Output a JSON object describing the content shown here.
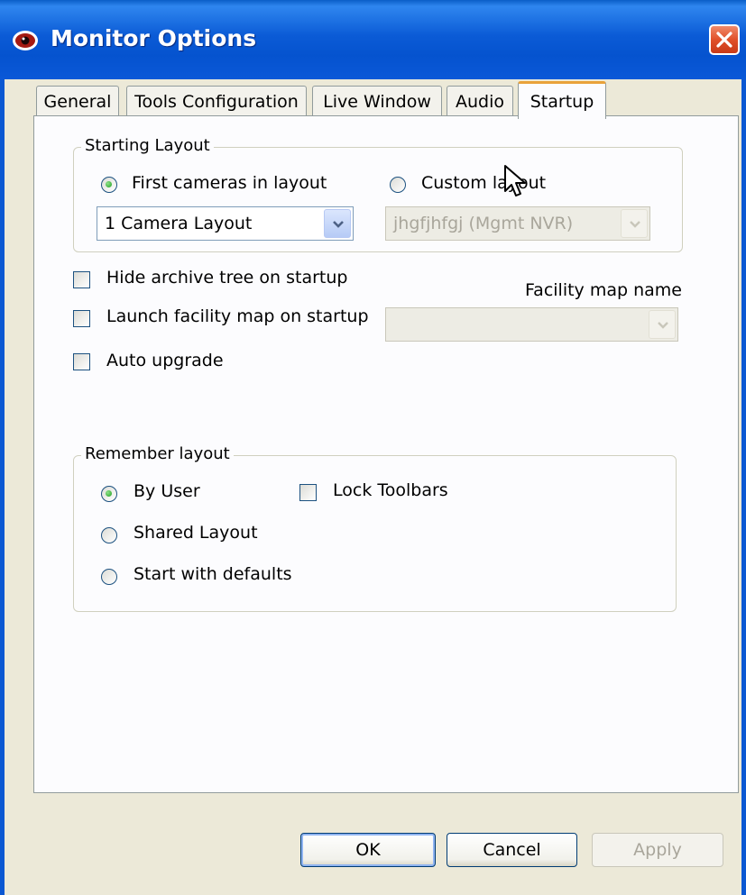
{
  "window": {
    "title": "Monitor Options"
  },
  "tabs": [
    {
      "label": "General"
    },
    {
      "label": "Tools Configuration"
    },
    {
      "label": "Live Window"
    },
    {
      "label": "Audio"
    },
    {
      "label": "Startup",
      "active": true
    }
  ],
  "starting_layout": {
    "group_label": "Starting Layout",
    "first_cameras_label": "First cameras in layout",
    "first_cameras_selected": true,
    "custom_layout_label": "Custom layout",
    "custom_layout_selected": false,
    "camera_layout_value": "1 Camera Layout",
    "custom_layout_value": "jhgfjhfgj (Mgmt NVR)"
  },
  "options": {
    "hide_archive_label": "Hide archive tree on startup",
    "hide_archive_checked": false,
    "launch_facility_label": "Launch facility map on startup",
    "launch_facility_checked": false,
    "auto_upgrade_label": "Auto upgrade",
    "auto_upgrade_checked": false,
    "facility_map_name_label": "Facility map name",
    "facility_map_value": ""
  },
  "remember_layout": {
    "group_label": "Remember layout",
    "by_user_label": "By User",
    "by_user_selected": true,
    "shared_layout_label": "Shared Layout",
    "start_defaults_label": "Start with defaults",
    "lock_toolbars_label": "Lock Toolbars",
    "lock_toolbars_checked": false
  },
  "buttons": {
    "ok": "OK",
    "cancel": "Cancel",
    "apply": "Apply"
  },
  "colors": {
    "titlebar": "#0b5bd6",
    "close": "#e1502a",
    "face": "#ece9d8",
    "radio_dot": "#21a121"
  }
}
